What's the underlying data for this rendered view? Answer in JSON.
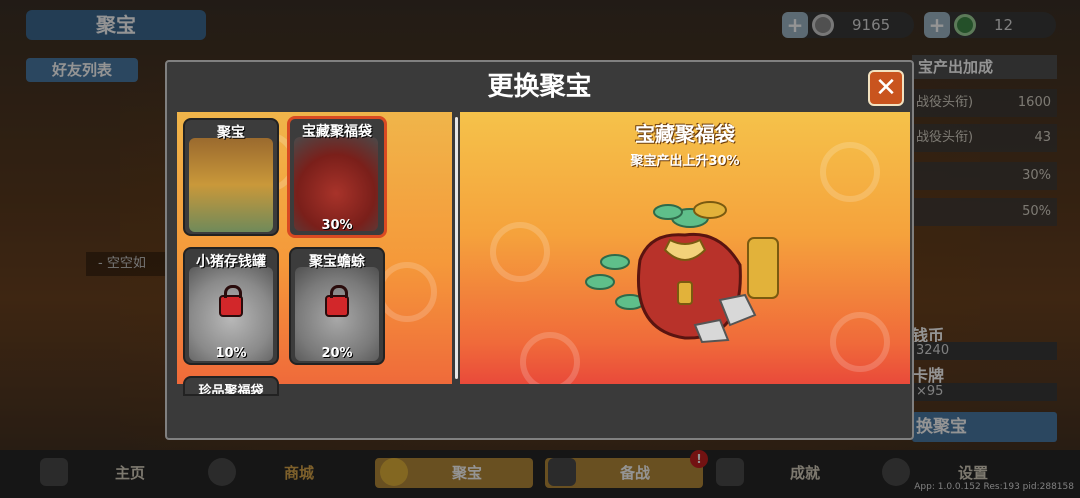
{
  "header": {
    "title": "聚宝",
    "friend_tab": "好友列表"
  },
  "resources": [
    {
      "icon": "coin-icon",
      "value": "9165"
    },
    {
      "icon": "gem-icon",
      "value": "12"
    }
  ],
  "background_panel": {
    "heading": "宝产出加成",
    "rows": [
      {
        "label": "战役头衔)",
        "value": "1600"
      },
      {
        "label": "战役头衔)",
        "value": "43"
      },
      {
        "label": "",
        "value": "30%"
      },
      {
        "label": "",
        "value": "50%"
      }
    ],
    "coins_label": "钱币",
    "coins_value": "3240",
    "cards_label": "卡牌",
    "cards_value": "×95",
    "change_button": "换聚宝",
    "empty_text": "- 空空如"
  },
  "modal": {
    "title": "更换聚宝",
    "close_label": "✕",
    "items": [
      {
        "name": "聚宝",
        "pct": "",
        "locked": false,
        "selected": false
      },
      {
        "name": "宝藏聚福袋",
        "pct": "30%",
        "locked": false,
        "selected": true
      },
      {
        "name": "小猪存钱罐",
        "pct": "10%",
        "locked": true,
        "selected": false
      },
      {
        "name": "聚宝蟾蜍",
        "pct": "20%",
        "locked": true,
        "selected": false
      }
    ],
    "peek_item": "珍品聚福袋",
    "detail": {
      "name": "宝藏聚福袋",
      "desc": "聚宝产出上升30%"
    }
  },
  "nav": {
    "items": [
      {
        "label": "主页",
        "icon": "home-icon"
      },
      {
        "label": "商城",
        "icon": "coins-icon"
      },
      {
        "label": "聚宝",
        "icon": "treasure-icon"
      },
      {
        "label": "备战",
        "icon": "card-icon"
      },
      {
        "label": "成就",
        "icon": "achievement-icon"
      },
      {
        "label": "设置",
        "icon": "gear-icon"
      }
    ],
    "badge": "!"
  },
  "version": "App: 1.0.0.152 Res:193 pid:288158"
}
